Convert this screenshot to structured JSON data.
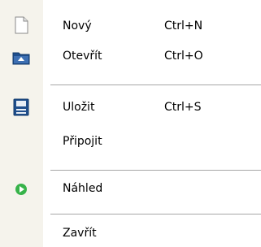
{
  "menu": {
    "items": [
      {
        "label": "Nový",
        "shortcut": "Ctrl+N",
        "icon": "new-document-icon"
      },
      {
        "label": "Otevřít",
        "shortcut": "Ctrl+O",
        "icon": "open-icon"
      },
      {
        "label": "Uložit",
        "shortcut": "Ctrl+S",
        "icon": "save-icon"
      },
      {
        "label": "Připojit",
        "shortcut": "",
        "icon": ""
      },
      {
        "label": "Náhled",
        "shortcut": "",
        "icon": "play-icon"
      },
      {
        "label": "Zavřít",
        "shortcut": "",
        "icon": ""
      }
    ]
  },
  "colors": {
    "gutter": "#f5f3ec",
    "separator": "#a6a6a6",
    "icon_blue": "#1f4e8c",
    "icon_green": "#37b34a"
  }
}
